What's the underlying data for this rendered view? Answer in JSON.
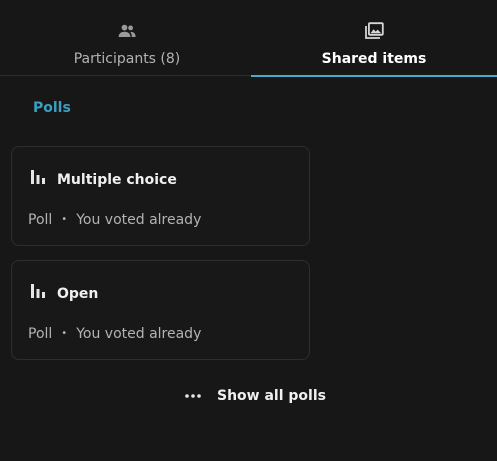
{
  "tabs": [
    {
      "label": "Participants (8)",
      "icon": "account-group-icon",
      "active": false
    },
    {
      "label": "Shared items",
      "icon": "image-multiple-icon",
      "active": true
    }
  ],
  "section": {
    "title": "Polls"
  },
  "polls": [
    {
      "title": "Multiple choice",
      "type": "Poll",
      "separator": "•",
      "status": "You voted already",
      "icon": "poll-icon"
    },
    {
      "title": "Open",
      "type": "Poll",
      "separator": "•",
      "status": "You voted already",
      "icon": "poll-icon"
    }
  ],
  "show_all": {
    "label": "Show all polls",
    "icon": "dots-horizontal-icon"
  },
  "colors": {
    "background": "#171717",
    "accent": "#4aa9c8",
    "section_title": "#3a9fc1"
  }
}
